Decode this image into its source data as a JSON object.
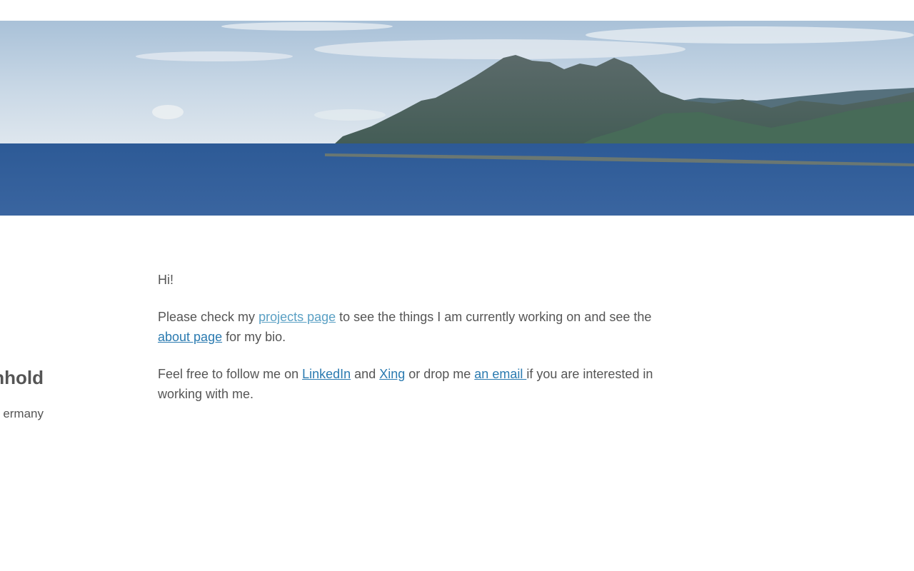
{
  "banner": {
    "image": "coastal-mountain-sea-banner"
  },
  "sidebar": {
    "name": "nhold",
    "location": "ermany"
  },
  "content": {
    "greeting": "Hi!",
    "p1": {
      "before": "Please check my ",
      "projects_link": "projects page",
      "middle": " to see the things I am currently working on and see the ",
      "about_link": "about page",
      "after": " for my bio."
    },
    "p2": {
      "before": "Feel free to follow me on ",
      "linkedin_link": "LinkedIn",
      "and": " and ",
      "xing_link": "Xing",
      "drop": " or drop me ",
      "email_link": "an email ",
      "after": "if you are interested in working with me."
    }
  },
  "colors": {
    "text": "#555555",
    "link": "#2a7ab0",
    "link_visited": "#5aa0c4",
    "sea": "#2f5b97",
    "sky": "#c9d8e6"
  }
}
